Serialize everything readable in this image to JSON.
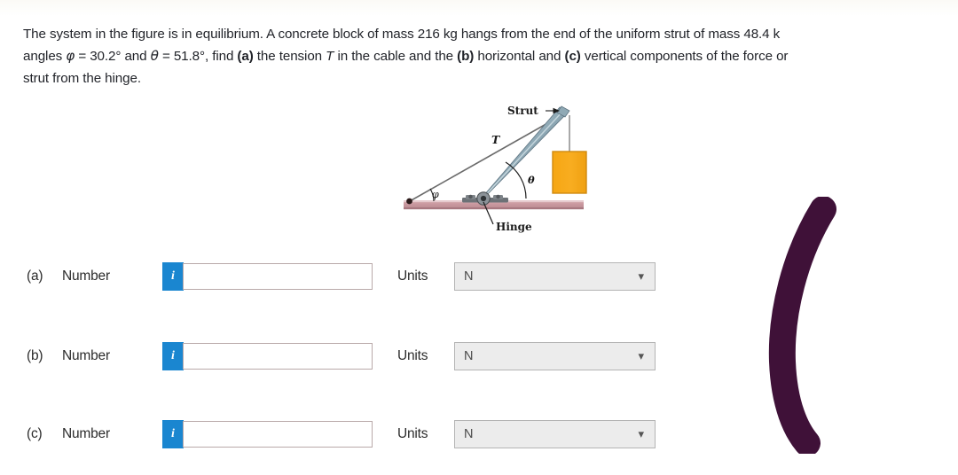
{
  "page": {
    "background_color": "#ffffff"
  },
  "prompt": {
    "line1_a": "The system in the figure is in equilibrium. A concrete block of mass ",
    "mass_block": "216 kg",
    "line1_b": " hangs from the end of the uniform strut of mass ",
    "mass_strut": "48.4 k",
    "line2_a": "angles ",
    "phi_symbol": "φ",
    "phi_value": " = 30.2° and ",
    "theta_symbol": "θ",
    "theta_value": " = 51.8°, find ",
    "part_a_bold": "(a)",
    "line2_b": " the tension ",
    "tension_symbol": "T",
    "line2_c": " in the cable and the ",
    "part_b_bold": "(b)",
    "line2_d": " horizontal and ",
    "part_c_bold": "(c)",
    "line2_e": " vertical components of the force or",
    "line3": "strut from the hinge."
  },
  "figure": {
    "strut_label": "Strut",
    "tension_label": "T",
    "hinge_label": "Hinge",
    "theta_label": "θ",
    "phi_label": "φ",
    "colors": {
      "ground": "#c99aa0",
      "ground_top": "#dcb9bd",
      "strut_light": "#b9ccd4",
      "strut_dark": "#6e8a99",
      "block": "#f7a81b",
      "block_border": "#d68a0c",
      "cable": "#8c8c8c",
      "hinge": "#5a5f63"
    }
  },
  "answers": {
    "units_options": [
      "N"
    ],
    "rows": [
      {
        "part": "(a)",
        "number_label": "Number",
        "info_icon": "i",
        "value": "",
        "units_label": "Units",
        "units_value": "N"
      },
      {
        "part": "(b)",
        "number_label": "Number",
        "info_icon": "i",
        "value": "",
        "units_label": "Units",
        "units_value": "N"
      },
      {
        "part": "(c)",
        "number_label": "Number",
        "info_icon": "i",
        "value": "",
        "units_label": "Units",
        "units_value": "N"
      }
    ]
  },
  "annotation": {
    "shape": "hand-drawn-curved-stroke",
    "color": "#3f1138"
  }
}
